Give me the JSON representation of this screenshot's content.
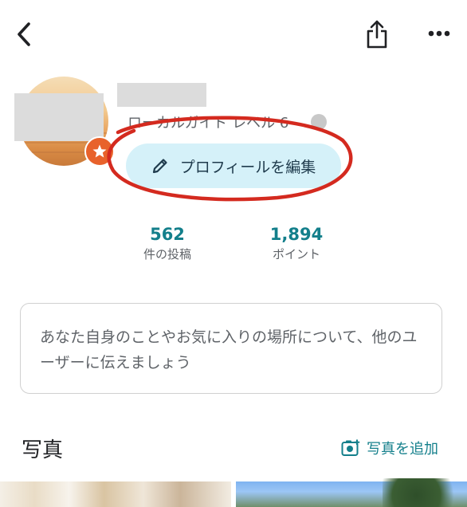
{
  "header": {
    "back_icon": "chevron-left-icon",
    "share_icon": "share-icon",
    "more_icon": "more-horizontal-icon"
  },
  "profile": {
    "level_text": "ローカルガイド レベル 6",
    "edit_button_label": "プロフィールを編集"
  },
  "stats": [
    {
      "value": "562",
      "label": "件の投稿"
    },
    {
      "value": "1,894",
      "label": "ポイント"
    }
  ],
  "bio": {
    "placeholder": "あなた自身のことやお気に入りの場所について、他のユーザーに伝えましょう"
  },
  "photos": {
    "title": "写真",
    "add_label": "写真を追加"
  },
  "colors": {
    "accent_teal": "#137f8b",
    "edit_button_bg": "#d5f1f9",
    "badge_orange": "#e8622b",
    "annotation_red": "#d42a1f"
  }
}
